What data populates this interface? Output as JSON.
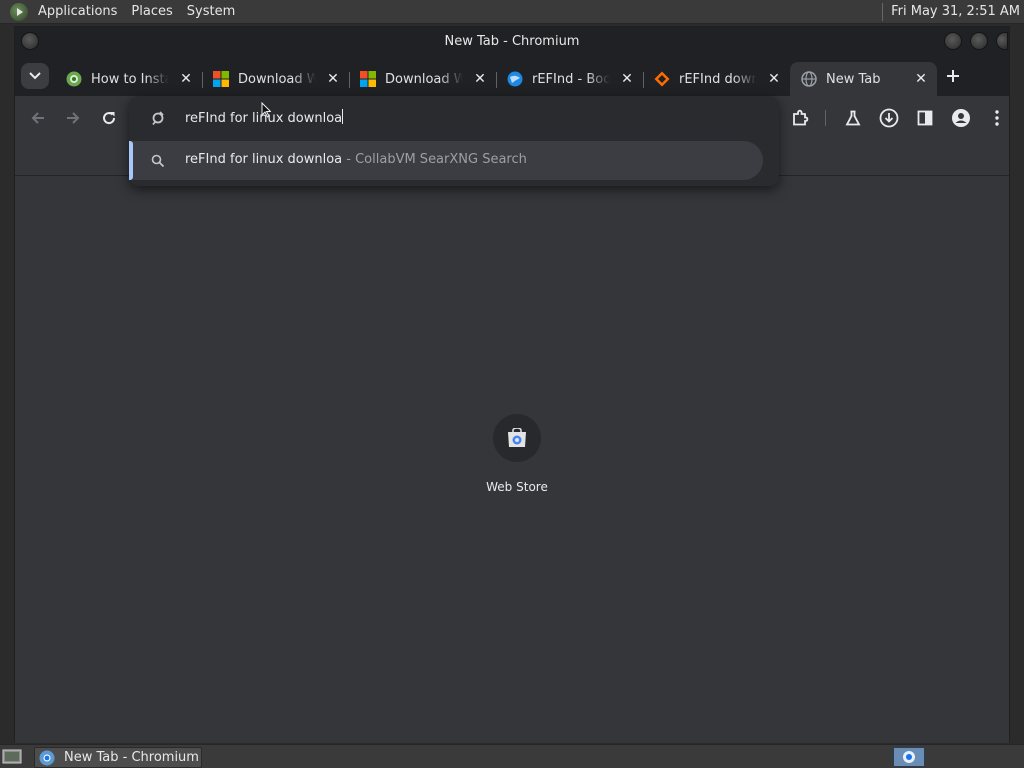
{
  "top_panel": {
    "menus": [
      "Applications",
      "Places",
      "System"
    ],
    "clock": "Fri May 31,  2:51 AM"
  },
  "window": {
    "title": "New Tab - Chromium"
  },
  "tabs": [
    {
      "label": "How to Instal",
      "favicon": "green-globe-icon"
    },
    {
      "label": "Download W",
      "favicon": "windows-logo-icon"
    },
    {
      "label": "Download W",
      "favicon": "windows-logo-icon"
    },
    {
      "label": "rEFInd - Boo",
      "favicon": "blue-globe-icon"
    },
    {
      "label": "rEFInd downl",
      "favicon": "orange-diamond-icon"
    },
    {
      "label": "New Tab",
      "favicon": "globe-icon",
      "active": true
    }
  ],
  "omnibox": {
    "input_value": "reFInd for linux downloa",
    "suggestion": {
      "query": "reFInd for linux downloa",
      "source": " - CollabVM SearXNG Search"
    }
  },
  "shortcuts": [
    {
      "label": "Web Store",
      "icon": "web-store-icon"
    }
  ],
  "taskbar": {
    "task_label": "New Tab - Chromium"
  },
  "colors": {
    "accent": "#a8c7fa",
    "chrome_dark": "#202124",
    "content_bg": "#35363a"
  }
}
